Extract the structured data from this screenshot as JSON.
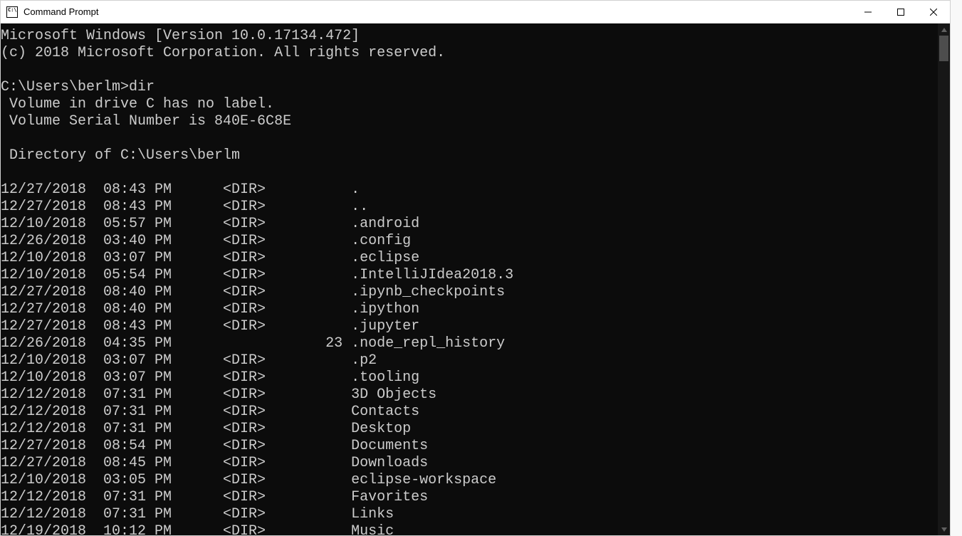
{
  "window": {
    "title": "Command Prompt",
    "icon_text": "C:\\."
  },
  "terminal": {
    "header_version": "Microsoft Windows [Version 10.0.17134.472]",
    "copyright": "(c) 2018 Microsoft Corporation. All rights reserved.",
    "prompt": "C:\\Users\\berlm>",
    "command": "dir",
    "volume_line": " Volume in drive C has no label.",
    "serial_line": " Volume Serial Number is 840E-6C8E",
    "directory_line": " Directory of C:\\Users\\berlm",
    "entries": [
      {
        "date": "12/27/2018",
        "time": "08:43 PM",
        "type": "<DIR>",
        "size": "",
        "name": "."
      },
      {
        "date": "12/27/2018",
        "time": "08:43 PM",
        "type": "<DIR>",
        "size": "",
        "name": ".."
      },
      {
        "date": "12/10/2018",
        "time": "05:57 PM",
        "type": "<DIR>",
        "size": "",
        "name": ".android"
      },
      {
        "date": "12/26/2018",
        "time": "03:40 PM",
        "type": "<DIR>",
        "size": "",
        "name": ".config"
      },
      {
        "date": "12/10/2018",
        "time": "03:07 PM",
        "type": "<DIR>",
        "size": "",
        "name": ".eclipse"
      },
      {
        "date": "12/10/2018",
        "time": "05:54 PM",
        "type": "<DIR>",
        "size": "",
        "name": ".IntelliJIdea2018.3"
      },
      {
        "date": "12/27/2018",
        "time": "08:40 PM",
        "type": "<DIR>",
        "size": "",
        "name": ".ipynb_checkpoints"
      },
      {
        "date": "12/27/2018",
        "time": "08:40 PM",
        "type": "<DIR>",
        "size": "",
        "name": ".ipython"
      },
      {
        "date": "12/27/2018",
        "time": "08:43 PM",
        "type": "<DIR>",
        "size": "",
        "name": ".jupyter"
      },
      {
        "date": "12/26/2018",
        "time": "04:35 PM",
        "type": "",
        "size": "23",
        "name": ".node_repl_history"
      },
      {
        "date": "12/10/2018",
        "time": "03:07 PM",
        "type": "<DIR>",
        "size": "",
        "name": ".p2"
      },
      {
        "date": "12/10/2018",
        "time": "03:07 PM",
        "type": "<DIR>",
        "size": "",
        "name": ".tooling"
      },
      {
        "date": "12/12/2018",
        "time": "07:31 PM",
        "type": "<DIR>",
        "size": "",
        "name": "3D Objects"
      },
      {
        "date": "12/12/2018",
        "time": "07:31 PM",
        "type": "<DIR>",
        "size": "",
        "name": "Contacts"
      },
      {
        "date": "12/12/2018",
        "time": "07:31 PM",
        "type": "<DIR>",
        "size": "",
        "name": "Desktop"
      },
      {
        "date": "12/27/2018",
        "time": "08:54 PM",
        "type": "<DIR>",
        "size": "",
        "name": "Documents"
      },
      {
        "date": "12/27/2018",
        "time": "08:45 PM",
        "type": "<DIR>",
        "size": "",
        "name": "Downloads"
      },
      {
        "date": "12/10/2018",
        "time": "03:05 PM",
        "type": "<DIR>",
        "size": "",
        "name": "eclipse-workspace"
      },
      {
        "date": "12/12/2018",
        "time": "07:31 PM",
        "type": "<DIR>",
        "size": "",
        "name": "Favorites"
      },
      {
        "date": "12/12/2018",
        "time": "07:31 PM",
        "type": "<DIR>",
        "size": "",
        "name": "Links"
      },
      {
        "date": "12/19/2018",
        "time": "10:12 PM",
        "type": "<DIR>",
        "size": "",
        "name": "Music"
      }
    ]
  }
}
